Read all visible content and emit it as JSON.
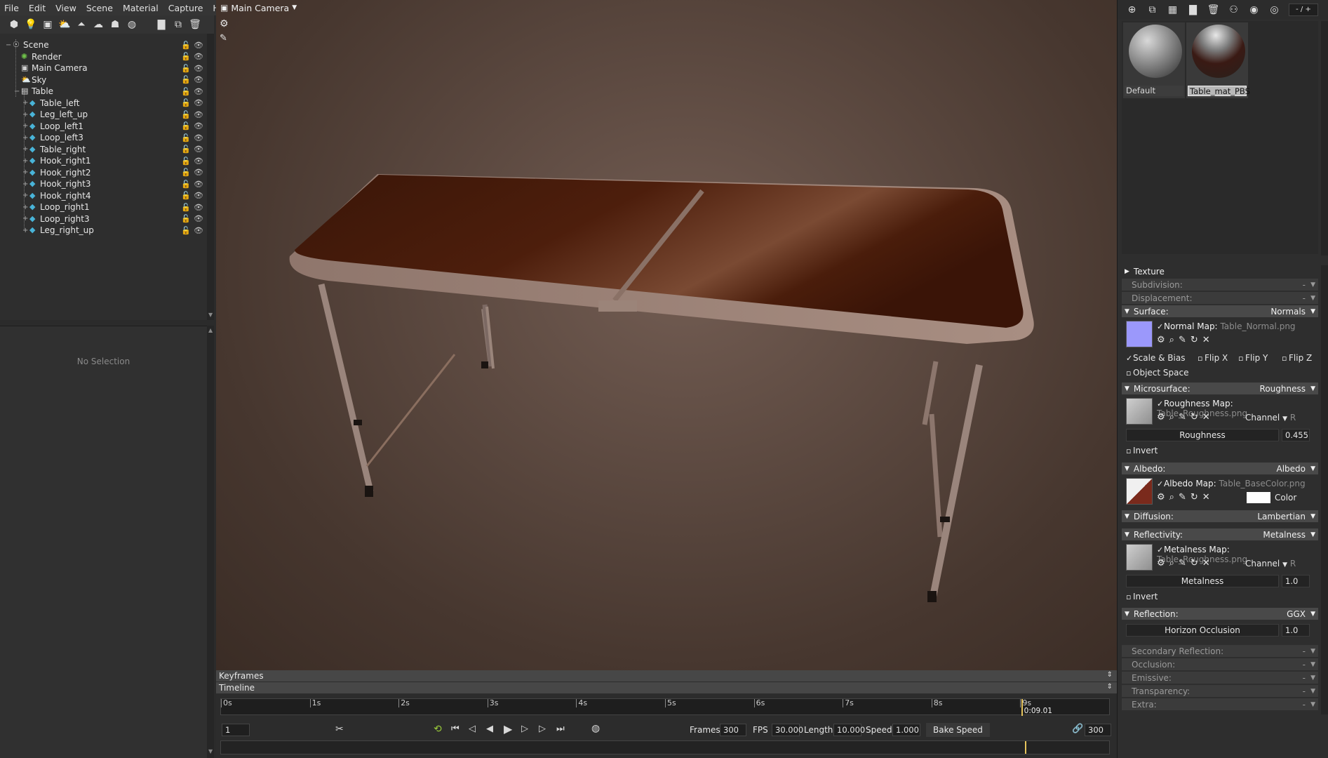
{
  "menu": [
    "File",
    "Edit",
    "View",
    "Scene",
    "Material",
    "Capture",
    "Help"
  ],
  "outliner": {
    "items": [
      {
        "label": "Scene",
        "icon": "scene-icon",
        "level": 0
      },
      {
        "label": "Render",
        "icon": "render-icon",
        "level": 1
      },
      {
        "label": "Main Camera",
        "icon": "camera-icon",
        "level": 1
      },
      {
        "label": "Sky",
        "icon": "sky-icon",
        "level": 1
      },
      {
        "label": "Table",
        "icon": "mesh-group-icon",
        "level": 1
      },
      {
        "label": "Table_left",
        "icon": "mesh-icon",
        "level": 2
      },
      {
        "label": "Leg_left_up",
        "icon": "mesh-icon",
        "level": 2
      },
      {
        "label": "Loop_left1",
        "icon": "mesh-icon",
        "level": 2
      },
      {
        "label": "Loop_left3",
        "icon": "mesh-icon",
        "level": 2
      },
      {
        "label": "Table_right",
        "icon": "mesh-icon",
        "level": 2
      },
      {
        "label": "Hook_right1",
        "icon": "mesh-icon",
        "level": 2
      },
      {
        "label": "Hook_right2",
        "icon": "mesh-icon",
        "level": 2
      },
      {
        "label": "Hook_right3",
        "icon": "mesh-icon",
        "level": 2
      },
      {
        "label": "Hook_right4",
        "icon": "mesh-icon",
        "level": 2
      },
      {
        "label": "Loop_right1",
        "icon": "mesh-icon",
        "level": 2
      },
      {
        "label": "Loop_right3",
        "icon": "mesh-icon",
        "level": 2
      },
      {
        "label": "Leg_right_up",
        "icon": "mesh-icon",
        "level": 2
      }
    ]
  },
  "selection": {
    "empty_text": "No Selection"
  },
  "viewport": {
    "camera_label": "Main Camera"
  },
  "timeline": {
    "keyframes_label": "Keyframes",
    "timeline_label": "Timeline",
    "ticks": [
      "0s",
      "1s",
      "2s",
      "3s",
      "4s",
      "5s",
      "6s",
      "7s",
      "8s",
      "9s"
    ],
    "playhead_time": "0:09.01",
    "playhead_fraction": 0.901,
    "frame_field": "1",
    "frames_label": "Frames",
    "frames_value": "300",
    "fps_label": "FPS",
    "fps_value": "30.000",
    "length_label": "Length",
    "length_value": "10.000",
    "speed_label": "Speed",
    "speed_value": "1.000",
    "bake_label": "Bake Speed",
    "end_frame": "300"
  },
  "materials": {
    "page_indicator": "- / +",
    "items": [
      {
        "name": "Default"
      },
      {
        "name": "Table_mat_PBS",
        "selected": true
      }
    ]
  },
  "props": {
    "texture_label": "Texture",
    "subdivision_label": "Subdivision:",
    "subdivision_value": "-",
    "displacement_label": "Displacement:",
    "displacement_value": "-",
    "surface_label": "Surface:",
    "surface_mode": "Normals",
    "normal_map_label": "Normal Map:",
    "normal_map_file": "Table_Normal.png",
    "scale_bias": "Scale & Bias",
    "flip_x": "Flip X",
    "flip_y": "Flip Y",
    "flip_z": "Flip Z",
    "object_space": "Object Space",
    "micro_label": "Microsurface:",
    "micro_mode": "Roughness",
    "rough_map_label": "Roughness Map:",
    "rough_map_file": "Table_Roughness.png",
    "channel_label": "Channel",
    "channel_value": "R",
    "roughness_label": "Roughness",
    "roughness_value": "0.455",
    "invert": "Invert",
    "albedo_label": "Albedo:",
    "albedo_mode": "Albedo",
    "albedo_map_label": "Albedo Map:",
    "albedo_map_file": "Table_BaseColor.png",
    "color_label": "Color",
    "diffusion_label": "Diffusion:",
    "diffusion_mode": "Lambertian",
    "reflectivity_label": "Reflectivity:",
    "reflectivity_mode": "Metalness",
    "metal_map_label": "Metalness Map:",
    "metal_map_file": "Table_Roughness.png",
    "metalness_label": "Metalness",
    "metalness_value": "1.0",
    "reflection_label": "Reflection:",
    "reflection_mode": "GGX",
    "horizon_label": "Horizon Occlusion",
    "horizon_value": "1.0",
    "secondary_label": "Secondary Reflection:",
    "occlusion_label": "Occlusion:",
    "emissive_label": "Emissive:",
    "transparency_label": "Transparency:",
    "extra_label": "Extra:",
    "dash": "-"
  }
}
